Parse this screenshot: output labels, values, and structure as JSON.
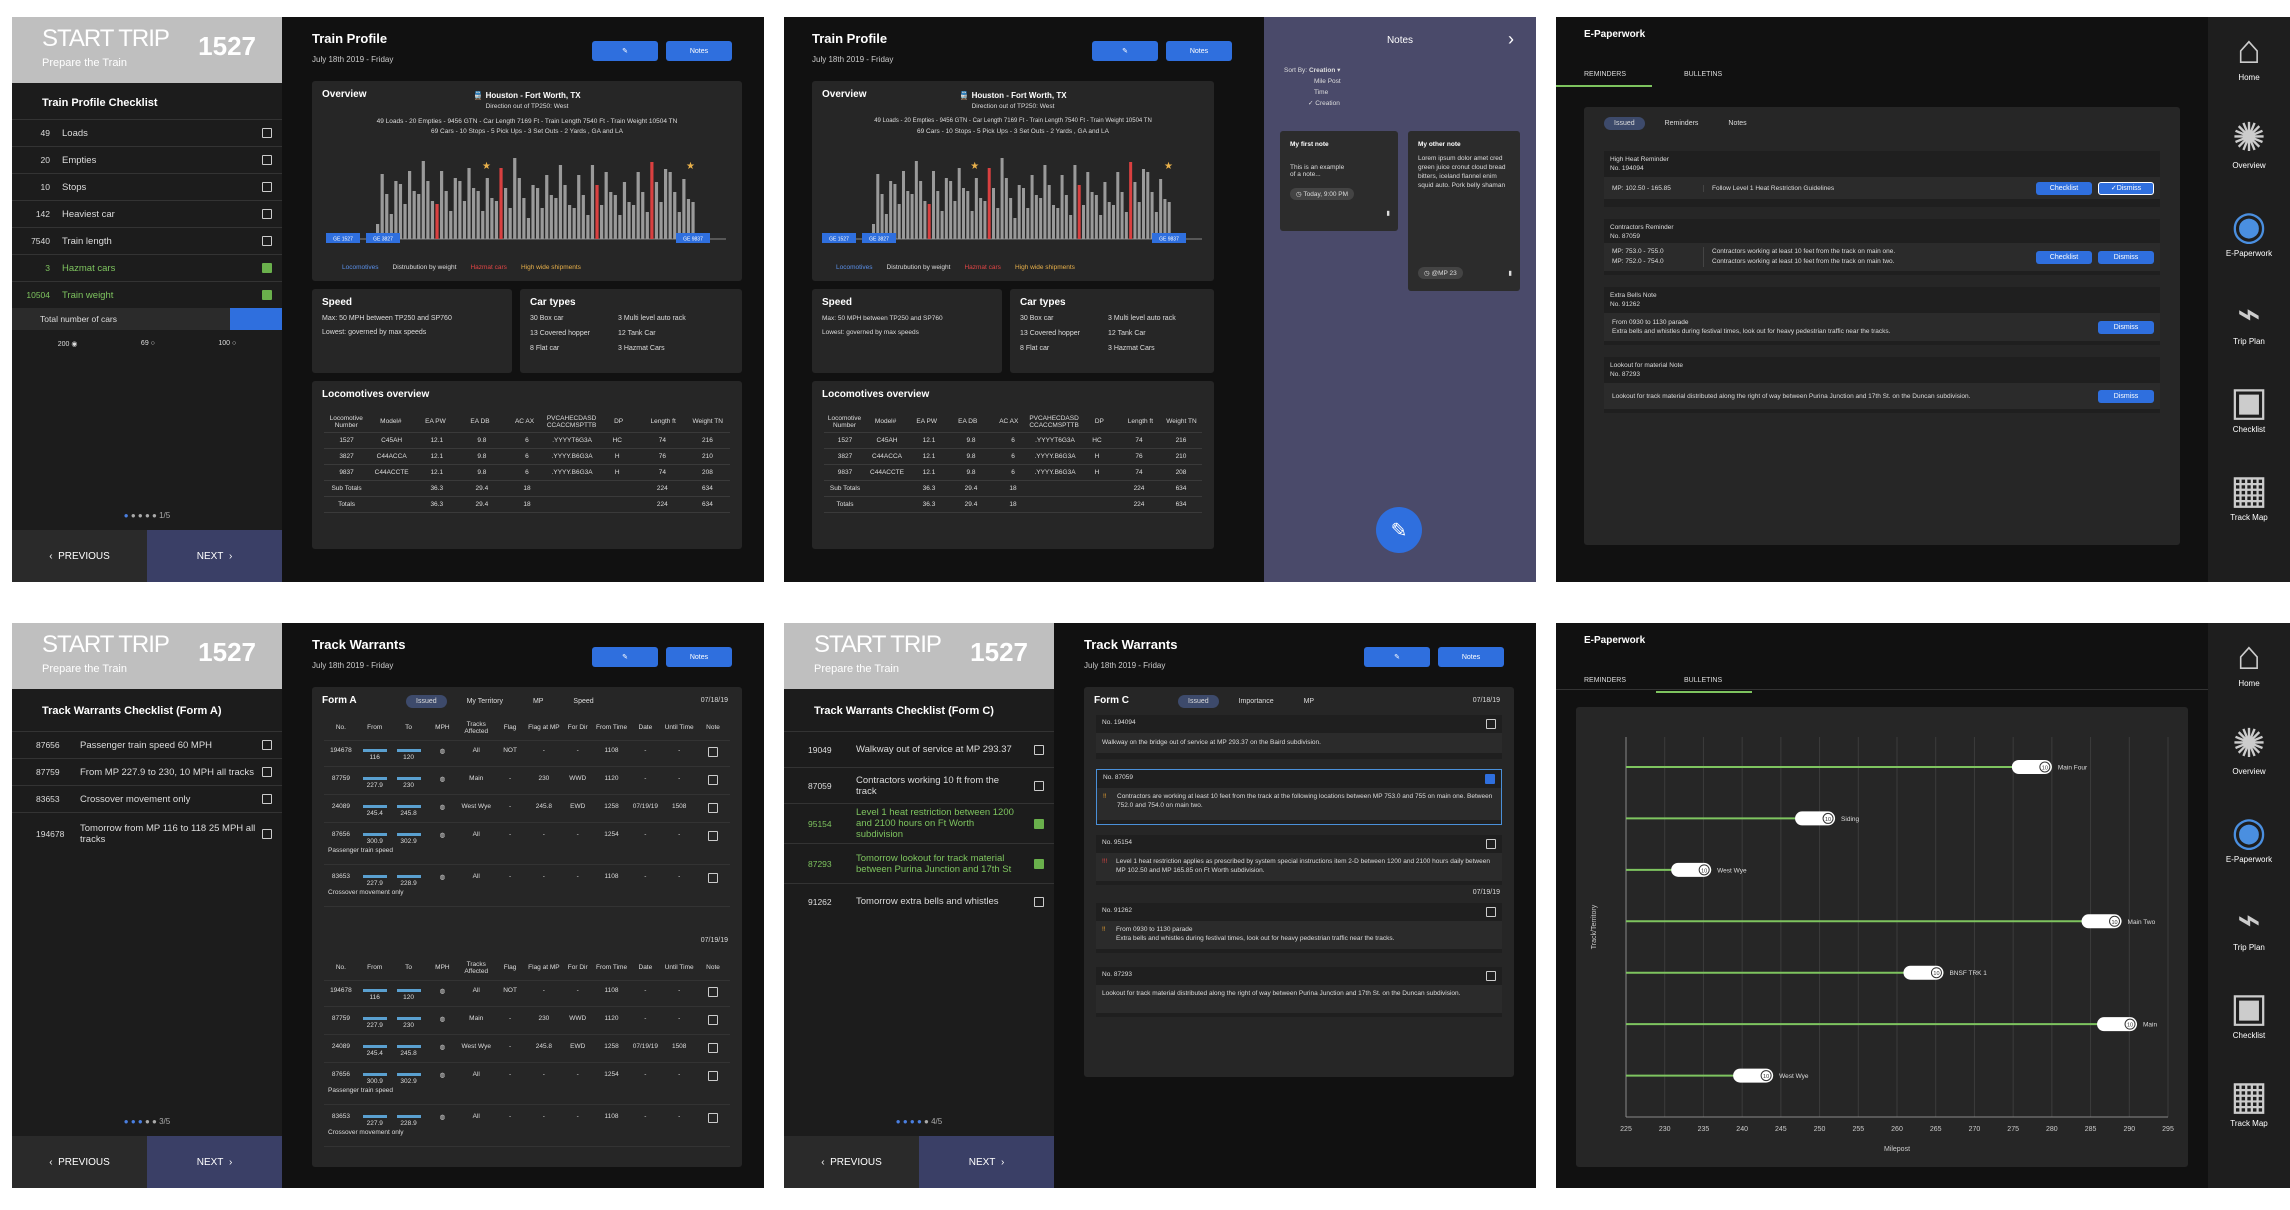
{
  "start_trip": {
    "title": "START TRIP",
    "subtitle": "Prepare the Train",
    "number": "1527"
  },
  "nav": {
    "previous": "PREVIOUS",
    "next": "NEXT"
  },
  "checklist": {
    "title": "Train Profile Checklist",
    "items": [
      {
        "value": "49",
        "label": "Loads",
        "checked": false
      },
      {
        "value": "20",
        "label": "Empties",
        "checked": false
      },
      {
        "value": "10",
        "label": "Stops",
        "checked": false
      },
      {
        "value": "142",
        "label": "Heaviest car",
        "checked": false
      },
      {
        "value": "7540",
        "label": "Train length",
        "checked": false
      },
      {
        "value": "3",
        "label": "Hazmat cars",
        "checked": true
      },
      {
        "value": "10504",
        "label": "Train weight",
        "checked": true
      }
    ],
    "total_label": "Total number of cars",
    "options": [
      "200",
      "69",
      "100"
    ],
    "page": "1/5"
  },
  "profile": {
    "title": "Train Profile",
    "date": "July 18th 2019 - Friday",
    "notes_btn": "Notes",
    "overview_title": "Overview",
    "route": "Houston - Fort Worth, TX",
    "direction": "Direction out of TP250: West",
    "summary1": "49 Loads - 20 Empties - 9456 GTN - Car Length 7169 Ft - Train Length 7540 Ft - Train Weight 10504 TN",
    "summary2": "69 Cars - 10 Stops - 5 Pick Ups - 3 Set Outs - 2 Yards , GA and LA",
    "legend": [
      "Locomotives",
      "Distrubution by weight",
      "Hazmat cars",
      "High wide shipments"
    ],
    "tags": [
      "GE 1527",
      "GE 3827",
      "GE 9837"
    ],
    "speed_title": "Speed",
    "speed1": "Max: 50 MPH between TP250 and SP760",
    "speed2": "Lowest: governed by max speeds",
    "car_title": "Car types",
    "car_types": [
      "30 Box car",
      "3 Multi level auto rack",
      "13 Covered hopper",
      "12 Tank Car",
      "8 Flat car",
      "3 Hazmat Cars"
    ],
    "loco_title": "Locomotives overview",
    "loco_headers": [
      "Locomotive Number",
      "Model#",
      "EA PW",
      "EA DB",
      "AC AX",
      "PVCAHECDASD CCACCMSPTTB",
      "DP",
      "Length ft",
      "Weight TN"
    ],
    "loco_rows": [
      [
        "1527",
        "C45AH",
        "12.1",
        "9.8",
        "6",
        ".YYYYT6G3A",
        "HC",
        "74",
        "216"
      ],
      [
        "3827",
        "C44ACCA",
        "12.1",
        "9.8",
        "6",
        ".YYYY.B6G3A",
        "H",
        "76",
        "210"
      ],
      [
        "9837",
        "C44ACCTE",
        "12.1",
        "9.8",
        "6",
        ".YYYY.B6G3A",
        "H",
        "74",
        "208"
      ],
      [
        "Sub Totals",
        "",
        "36.3",
        "29.4",
        "18",
        "",
        "",
        "224",
        "634"
      ],
      [
        "Totals",
        "",
        "36.3",
        "29.4",
        "18",
        "",
        "",
        "224",
        "634"
      ]
    ]
  },
  "notes": {
    "title": "Notes",
    "sort_label": "Sort By:",
    "sort_current": "Creation",
    "sort_options": [
      "Mile Post",
      "Time",
      "Creation"
    ],
    "n1_title": "My first note",
    "n1_body": "This is an example of a note...",
    "n1_time": "Today, 9:00 PM",
    "n2_title": "My other note",
    "n2_body": "Lorem ipsum dolor amet cred green juice cronut cloud bread bitters, iceland flannel enim squid auto. Pork belly shaman",
    "n2_tag": "@MP 23"
  },
  "epaper": {
    "title": "E-Paperwork",
    "tab_reminders": "REMINDERS",
    "tab_bulletins": "BULLETINS",
    "sub_tabs": [
      "Issued",
      "Reminders",
      "Notes"
    ],
    "r1_title": "High Heat Reminder",
    "r1_no": "No. 194094",
    "r1_mp": "MP: 102.50 - 165.85",
    "r1_text": "Follow Level 1 Heat Restriction Guidelines",
    "r2_title": "Contractors Reminder",
    "r2_no": "No. 87059",
    "r2_mp1": "MP: 753.0 - 755.0",
    "r2_mp2": "MP: 752.0 - 754.0",
    "r2_text1": "Contractors working at least 10 feet from the track on main one.",
    "r2_text2": "Contractors working at least 10 feet from the track on main two.",
    "r3_title": "Extra Bells Note",
    "r3_no": "No. 91262",
    "r3_text1": "From 0930 to 1130 parade",
    "r3_text2": "Extra bells and whistles during festival times, look out for heavy pedestrian traffic near the tracks.",
    "r4_title": "Lookout for material Note",
    "r4_no": "No. 87293",
    "r4_text": "Lookout for track material distributed along the right of way between Purina Junction and 17th St. on the Duncan subdivision.",
    "checklist_btn": "Checklist",
    "dismiss_btn": "Dismiss"
  },
  "sidebar": [
    "Home",
    "Overview",
    "E-Paperwork",
    "Trip Plan",
    "Checklist",
    "Track Map"
  ],
  "warrants_a": {
    "title": "Track Warrants Checklist (Form A)",
    "items": [
      {
        "no": "87656",
        "text": "Passenger train speed 60 MPH"
      },
      {
        "no": "87759",
        "text": "From MP 227.9 to 230, 10 MPH all tracks"
      },
      {
        "no": "83653",
        "text": "Crossover movement only"
      },
      {
        "no": "194678",
        "text": "Tomorrow from MP 116 to 118 25 MPH all tracks"
      }
    ],
    "page": "3/5"
  },
  "warrants": {
    "title": "Track Warrants",
    "date": "July 18th 2019 - Friday",
    "notes_btn": "Notes",
    "forma": "Form A",
    "tabs": [
      "Issued",
      "My Territory",
      "MP",
      "Speed"
    ],
    "date1": "07/18/19",
    "date2": "07/19/19",
    "headers": [
      "No.",
      "From",
      "To",
      "MPH",
      "Tracks Affected",
      "Flag",
      "Flag at MP",
      "For Dir",
      "From Time",
      "Date",
      "Until Time",
      "Note"
    ],
    "rows": [
      [
        "194678",
        "116",
        "120",
        "",
        "All",
        "NOT",
        "-",
        "-",
        "1108",
        "-",
        "-",
        ""
      ],
      [
        "87759",
        "227.9",
        "230",
        "",
        "Main",
        "-",
        "230",
        "WWD",
        "1120",
        "-",
        "-",
        ""
      ],
      [
        "24089",
        "245.4",
        "245.8",
        "",
        "West Wye",
        "-",
        "245.8",
        "EWD",
        "1258",
        "07/19/19",
        "1508",
        ""
      ],
      [
        "87656",
        "300.9",
        "302.9",
        "",
        "All",
        "-",
        "-",
        "-",
        "1254",
        "-",
        "-",
        ""
      ],
      [
        "83653",
        "227.9",
        "228.9",
        "",
        "All",
        "-",
        "-",
        "-",
        "1108",
        "-",
        "-",
        ""
      ]
    ],
    "note_passenger": "Passenger train speed",
    "note_crossover": "Crossover movement only"
  },
  "warrants_c": {
    "title": "Track Warrants Checklist (Form C)",
    "items": [
      {
        "no": "19049",
        "text": "Walkway out of service at MP 293.37",
        "checked": false,
        "green": false
      },
      {
        "no": "87059",
        "text": "Contractors working 10 ft from the track",
        "checked": false,
        "green": false
      },
      {
        "no": "95154",
        "text": "Level 1 heat restriction between 1200 and 2100 hours on Ft Worth subdivision",
        "checked": true,
        "green": true
      },
      {
        "no": "87293",
        "text": "Tomorrow lookout for track material between Purina Junction and 17th St",
        "checked": true,
        "green": true
      },
      {
        "no": "91262",
        "text": "Tomorrow extra bells and whistles",
        "checked": false,
        "green": false
      }
    ],
    "page": "4/5"
  },
  "formc": {
    "title": "Form C",
    "tabs": [
      "Issued",
      "Importance",
      "MP"
    ],
    "date1": "07/18/19",
    "date2": "07/19/19",
    "c1_no": "No. 194094",
    "c1_text": "Walkway on the bridge out of service at MP 293.37 on the Baird subdivision.",
    "c2_no": "No. 87059",
    "c2_text": "Contractors are working at least 10 feet from the track at the following locations between MP 753.0 and 755 on main one. Between 752.0 and 754.0 on main two.",
    "c3_no": "No. 95154",
    "c3_text": "Level 1 heat restriction applies as prescribed by system special instructions item 2-D between 1200 and 2100 hours daily between MP 102.50 and MP 165.85 on Ft Worth subdivision.",
    "c4_no": "No. 91262",
    "c4_text1": "From 0930 to 1130 parade",
    "c4_text2": "Extra bells and whistles during festival times, look out for heavy pedestrian traffic near the tracks.",
    "c5_no": "No. 87293",
    "c5_text": "Lookout for track material distributed along the right of way between Purina Junction and 17th St. on the Duncan subdivision."
  },
  "chart_data": {
    "type": "bar",
    "xlabel": "Milepost",
    "ylabel": "Track/Territory",
    "xlim": [
      225,
      295
    ],
    "x_ticks": [
      225,
      230,
      235,
      240,
      245,
      250,
      255,
      260,
      265,
      270,
      275,
      280,
      285,
      290,
      295
    ],
    "rows": [
      {
        "label": "Main Four",
        "start": 225,
        "end": 280,
        "speed": "10"
      },
      {
        "label": "Siding",
        "start": 225,
        "end": 252,
        "speed": "10"
      },
      {
        "label": "West Wye",
        "start": 225,
        "end": 236,
        "speed": "10"
      },
      {
        "label": "Main Two",
        "start": 225,
        "end": 289,
        "speed": "10"
      },
      {
        "label": "BNSF TRK 1",
        "start": 225,
        "end": 266,
        "speed": "10"
      },
      {
        "label": "Main",
        "start": 225,
        "end": 291,
        "speed": "10"
      },
      {
        "label": "West Wye",
        "start": 225,
        "end": 244,
        "speed": "10"
      }
    ]
  }
}
